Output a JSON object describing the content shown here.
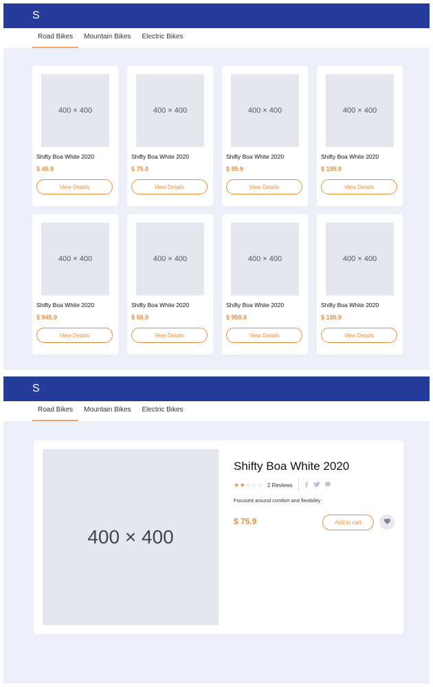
{
  "app": {
    "logo": "S"
  },
  "tabs": [
    {
      "label": "Road Bikes",
      "active": true
    },
    {
      "label": "Mountain Bikes",
      "active": false
    },
    {
      "label": "Electric Bikes",
      "active": false
    }
  ],
  "placeholder_text": "400 × 400",
  "product_list": {
    "view_details_label": "View Details",
    "items": [
      {
        "name": "Shifty Boa White 2020",
        "price": "$ 45.9"
      },
      {
        "name": "Shifty Boa White 2020",
        "price": "$ 75.9"
      },
      {
        "name": "Shifty Boa White 2020",
        "price": "$ 95.9"
      },
      {
        "name": "Shifty Boa White 2020",
        "price": "$ 195.9"
      },
      {
        "name": "Shifty Boa White 2020",
        "price": "$ 945.9"
      },
      {
        "name": "Shifty Boa White 2020",
        "price": "$ 50.9"
      },
      {
        "name": "Shifty Boa White 2020",
        "price": "$ 950.9"
      },
      {
        "name": "Shifty Boa White 2020",
        "price": "$ 195.9"
      }
    ]
  },
  "product_detail": {
    "title": "Shifty Boa White 2020",
    "rating": 2,
    "rating_max": 5,
    "reviews": "2 Reviews",
    "social_icons": [
      "facebook-icon",
      "twitter-icon",
      "comment-icon"
    ],
    "description": "Focused around comfort and flexibility",
    "price": "$ 75.9",
    "add_to_cart_label": "Add to cart",
    "favorite_icon": "heart-icon"
  },
  "colors": {
    "topbar": "#263c9b",
    "accent": "#f08b35",
    "page_background": "#eceff7",
    "placeholder": "#e4e8ee"
  }
}
